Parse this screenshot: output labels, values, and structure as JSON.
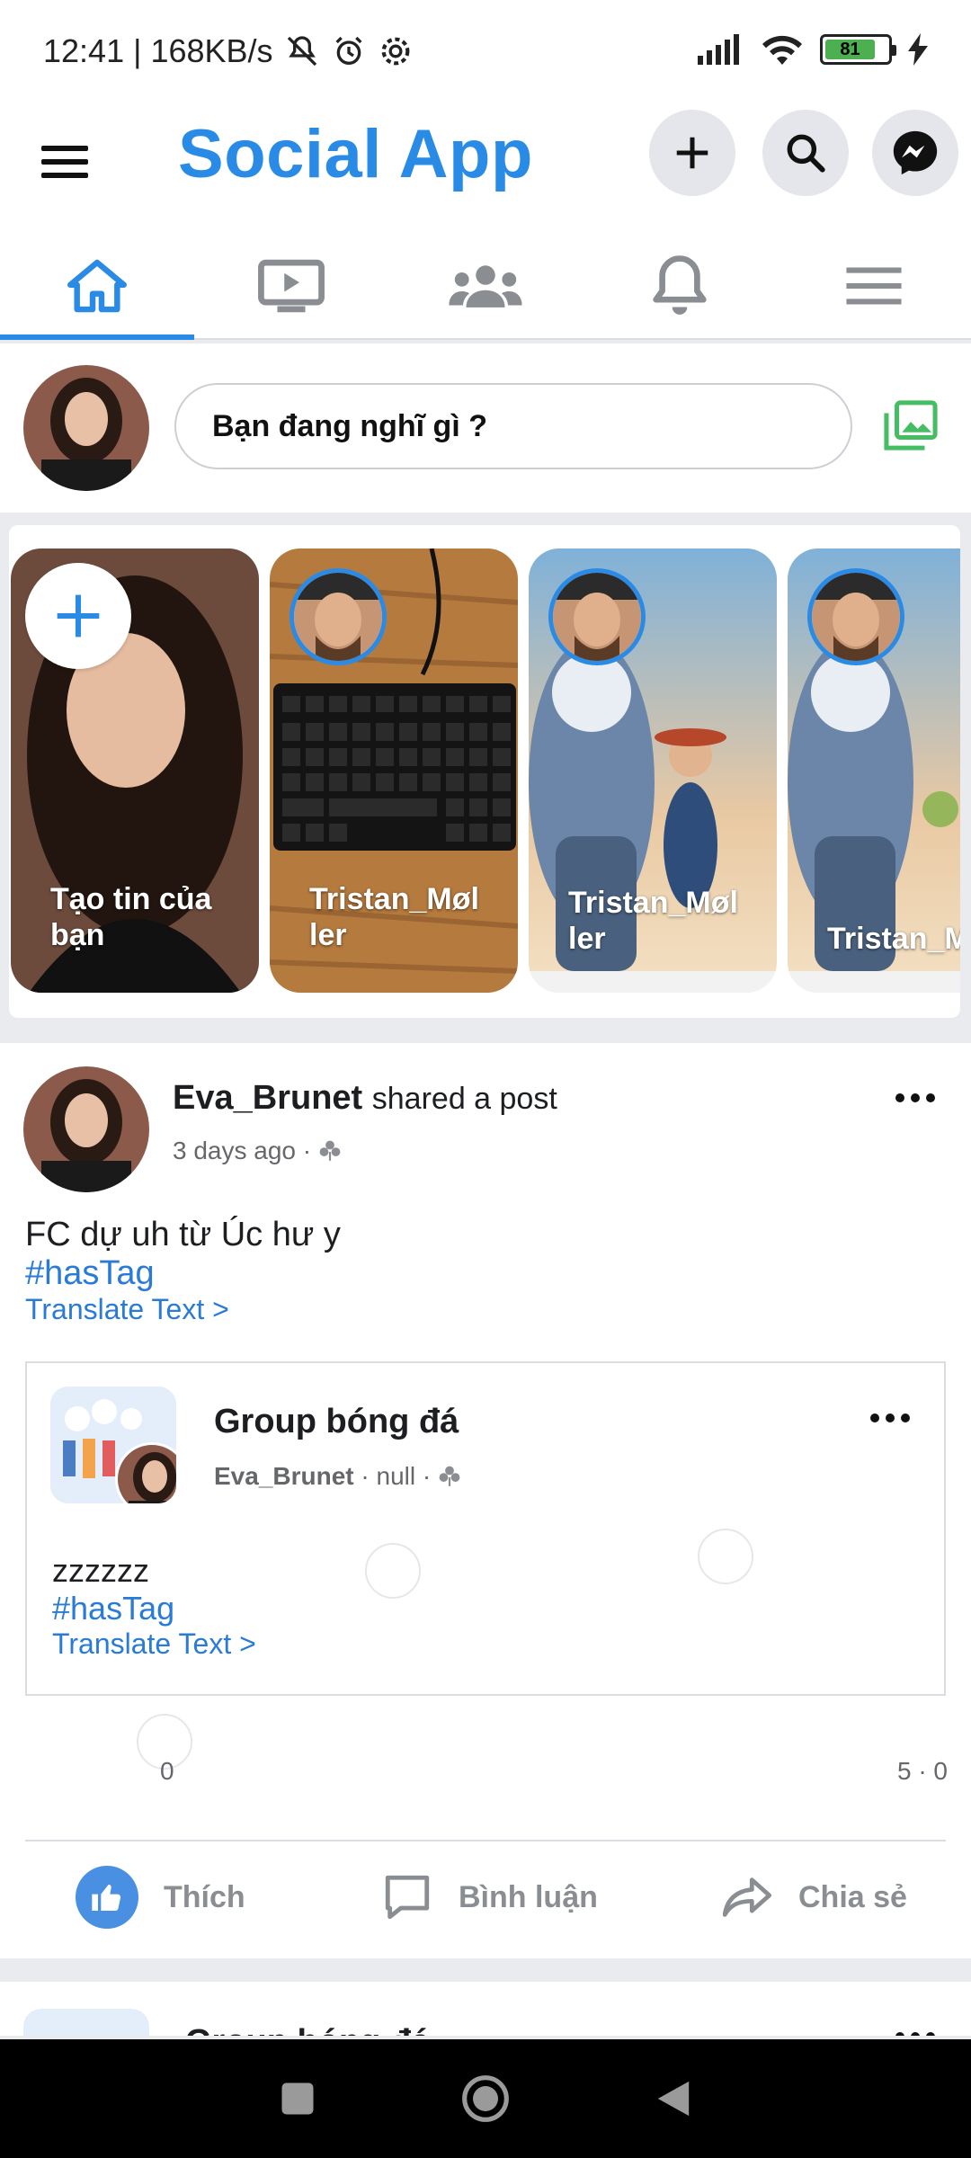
{
  "status_bar": {
    "time_speed": "12:41 | 168KB/s",
    "battery": "81"
  },
  "header": {
    "title": "Social App",
    "accent": "#2a8be6"
  },
  "tabs": [
    {
      "icon": "home-icon",
      "active": true
    },
    {
      "icon": "video-icon",
      "active": false
    },
    {
      "icon": "groups-icon",
      "active": false
    },
    {
      "icon": "bell-icon",
      "active": false
    },
    {
      "icon": "menu-icon",
      "active": false
    }
  ],
  "composer": {
    "placeholder": "Bạn đang nghĩ gì ?"
  },
  "stories": [
    {
      "name": "Tạo tin của bạn"
    },
    {
      "name": "Tristan_Møl ler"
    },
    {
      "name": "Tristan_Møl ler"
    },
    {
      "name": "Tristan_M ler"
    }
  ],
  "post": {
    "author": "Eva_Brunet",
    "action": "shared a post",
    "time": "3 days ago ·",
    "text": "FC dự uh từ Úc hư y",
    "hashtag": "#hasTag",
    "translate": "Translate Text >",
    "shared": {
      "group": "Group bóng đá",
      "author": "Eva_Brunet",
      "meta": "· null ·",
      "text": "zzzzzz",
      "hashtag": "#hasTag",
      "translate": "Translate Text >"
    },
    "reaction_count": "0",
    "comments_shares": "5 · 0",
    "actions": {
      "like": "Thích",
      "comment": "Bình luận",
      "share": "Chia sẻ"
    }
  },
  "next_post": {
    "title": "Group bóng đá"
  }
}
